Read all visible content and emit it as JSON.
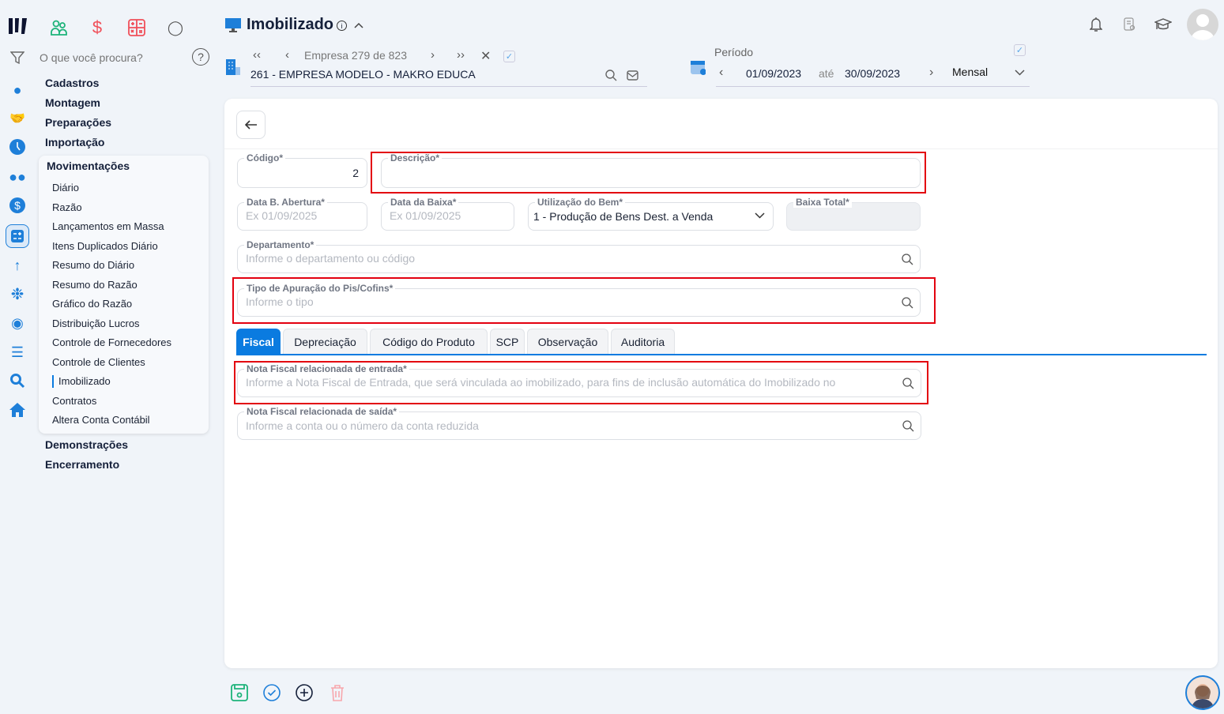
{
  "search": {
    "placeholder": "O que você procura?"
  },
  "sidebar": {
    "groups": [
      "Cadastros",
      "Montagem",
      "Preparações",
      "Importação"
    ],
    "open_group": "Movimentações",
    "items": [
      "Diário",
      "Razão",
      "Lançamentos em Massa",
      "Itens Duplicados Diário",
      "Resumo do Diário",
      "Resumo do Razão",
      "Gráfico do Razão",
      "Distribuição Lucros",
      "Controle de Fornecedores",
      "Controle de Clientes",
      "Imobilizado",
      "Contratos",
      "Altera Conta Contábil"
    ],
    "after_groups": [
      "Demonstrações",
      "Encerramento"
    ]
  },
  "header": {
    "title": "Imobilizado",
    "empresa_label": "Empresa",
    "empresa_index": "279",
    "de": "de",
    "empresa_total": "823",
    "empresa_name": "261 - EMPRESA MODELO - MAKRO EDUCA",
    "periodo_label": "Período",
    "date_from": "01/09/2023",
    "ate": "até",
    "date_to": "30/09/2023",
    "period_type": "Mensal"
  },
  "form": {
    "codigo": {
      "label": "Código*",
      "value": "2"
    },
    "descricao": {
      "label": "Descrição*",
      "value": ""
    },
    "data_abertura": {
      "label": "Data B. Abertura*",
      "placeholder": "Ex 01/09/2025"
    },
    "data_baixa": {
      "label": "Data da Baixa*",
      "placeholder": "Ex 01/09/2025"
    },
    "utilizacao": {
      "label": "Utilização do Bem*",
      "value": "1 - Produção de Bens Dest. a Venda"
    },
    "baixa_total": {
      "label": "Baixa Total*"
    },
    "departamento": {
      "label": "Departamento*",
      "placeholder": "Informe o departamento ou código"
    },
    "tipo_apuracao": {
      "label": "Tipo de Apuração do Pis/Cofins*",
      "placeholder": "Informe o tipo"
    },
    "nf_entrada": {
      "label": "Nota Fiscal relacionada de entrada*",
      "placeholder": "Informe a Nota Fiscal de Entrada, que será vinculada ao imobilizado, para fins de inclusão automática do Imobilizado no"
    },
    "nf_saida": {
      "label": "Nota Fiscal relacionada de saída*",
      "placeholder": "Informe a conta ou o número da conta reduzida"
    }
  },
  "tabs": [
    "Fiscal",
    "Depreciação",
    "Código do Produto",
    "SCP",
    "Observação",
    "Auditoria"
  ],
  "colors": {
    "accent": "#0a7be0",
    "highlight": "#e3000f",
    "save": "#1db37a",
    "delete": "#f7a6ac"
  }
}
